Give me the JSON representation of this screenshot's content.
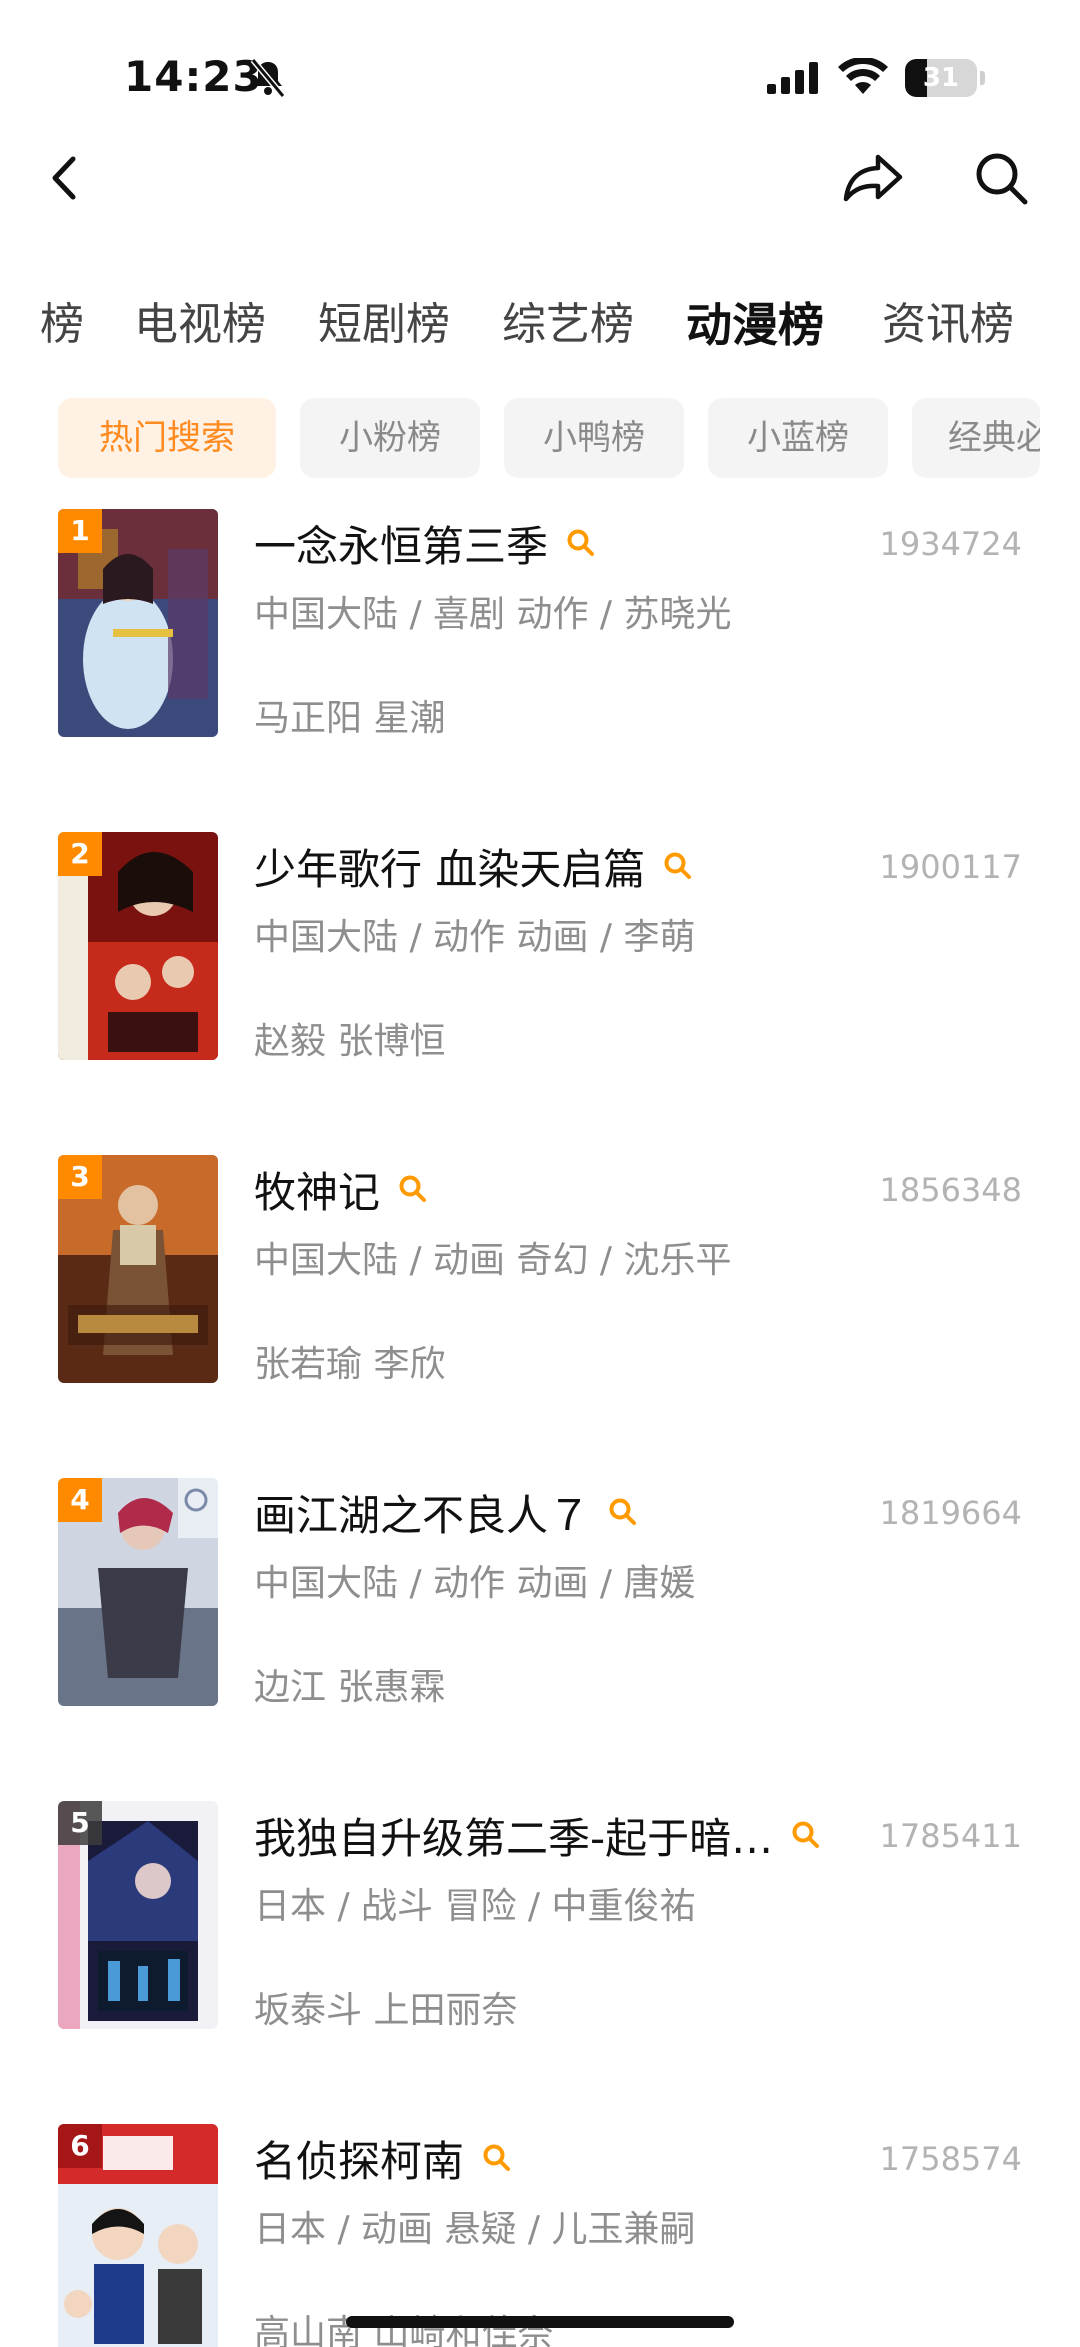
{
  "status_bar": {
    "time": "14:23",
    "battery_level": "31",
    "icons": [
      "bell-slash-icon",
      "cellular-signal-icon",
      "wifi-icon",
      "battery-icon"
    ]
  },
  "nav": {
    "icons": [
      "chevron-left-icon",
      "share-arrow-icon",
      "search-icon"
    ]
  },
  "category_tabs": [
    {
      "label": "榜",
      "active": false
    },
    {
      "label": "电视榜",
      "active": false
    },
    {
      "label": "短剧榜",
      "active": false
    },
    {
      "label": "综艺榜",
      "active": false
    },
    {
      "label": "动漫榜",
      "active": true
    },
    {
      "label": "资讯榜",
      "active": false
    }
  ],
  "chips": [
    {
      "label": "热门搜索",
      "active": true
    },
    {
      "label": "小粉榜",
      "active": false
    },
    {
      "label": "小鸭榜",
      "active": false
    },
    {
      "label": "小蓝榜",
      "active": false
    },
    {
      "label": "经典必",
      "active": false
    }
  ],
  "list": [
    {
      "rank": "1",
      "title": "一念永恒第三季",
      "count": "1934724",
      "meta": "中国大陆 / 喜剧 动作 / 苏晓光",
      "cast": "马正阳 星潮"
    },
    {
      "rank": "2",
      "title": "少年歌行 血染天启篇",
      "count": "1900117",
      "meta": "中国大陆 / 动作 动画 / 李萌",
      "cast": "赵毅 张博恒"
    },
    {
      "rank": "3",
      "title": "牧神记",
      "count": "1856348",
      "meta": "中国大陆 / 动画 奇幻 / 沈乐平",
      "cast": "张若瑜 李欣"
    },
    {
      "rank": "4",
      "title": "画江湖之不良人７",
      "count": "1819664",
      "meta": "中国大陆 / 动作 动画 / 唐媛",
      "cast": "边江 张惠霖"
    },
    {
      "rank": "5",
      "title": "我独自升级第二季-起于暗影-",
      "title_display": "我独自升级第二季-起于暗…",
      "count": "1785411",
      "meta": "日本 / 战斗 冒险 / 中重俊祐",
      "cast": "坂泰斗 上田丽奈"
    },
    {
      "rank": "6",
      "title": "名侦探柯南",
      "count": "1758574",
      "meta": "日本 / 动画 悬疑 / 儿玉兼嗣",
      "cast": "高山南 山崎和佳奈"
    }
  ],
  "colors": {
    "accent": "#ff8a1f",
    "chip_active_bg": "#fff1e3",
    "rank_top": "#ff8a00",
    "muted_text": "#8e8e8e"
  }
}
